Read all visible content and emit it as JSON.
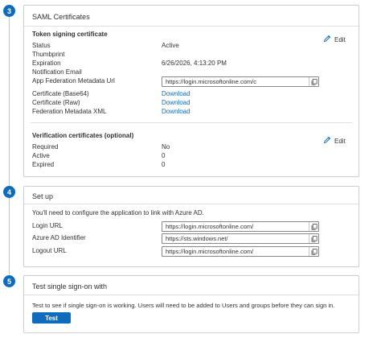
{
  "steps": {
    "three": "3",
    "four": "4",
    "five": "5"
  },
  "saml": {
    "title": "SAML Certificates",
    "token": {
      "heading": "Token signing certificate",
      "edit_label": "Edit",
      "status_label": "Status",
      "status_value": "Active",
      "thumbprint_label": "Thumbprint",
      "expiration_label": "Expiration",
      "expiration_value": "6/26/2026, 4:13:20 PM",
      "notification_label": "Notification Email",
      "metadata_url_label": "App Federation Metadata Url",
      "metadata_url_value": "https://login.microsoftonline.com/c",
      "base64_label": "Certificate (Base64)",
      "base64_link": "Download",
      "raw_label": "Certificate (Raw)",
      "raw_link": "Download",
      "fedxml_label": "Federation Metadata XML",
      "fedxml_link": "Download"
    },
    "verification": {
      "heading": "Verification certificates (optional)",
      "edit_label": "Edit",
      "required_label": "Required",
      "required_value": "No",
      "active_label": "Active",
      "active_value": "0",
      "expired_label": "Expired",
      "expired_value": "0"
    }
  },
  "setup": {
    "title": "Set up",
    "description": "You'll need to configure the application to link with Azure AD.",
    "login_url_label": "Login URL",
    "login_url_value": "https://login.microsoftonline.com/",
    "identifier_label": "Azure AD Identifier",
    "identifier_value": "https://sts.windows.net/",
    "logout_url_label": "Logout URL",
    "logout_url_value": "https://login.microsoftonline.com/"
  },
  "test": {
    "title": "Test single sign-on with",
    "description": "Test to see if single sign-on is working. Users will need to be added to Users and groups before they can sign in.",
    "button_label": "Test"
  },
  "colors": {
    "accent": "#0f6cbd",
    "border": "#d2d0ce"
  },
  "icons": {
    "edit": "pencil-icon",
    "copy": "copy-icon"
  }
}
